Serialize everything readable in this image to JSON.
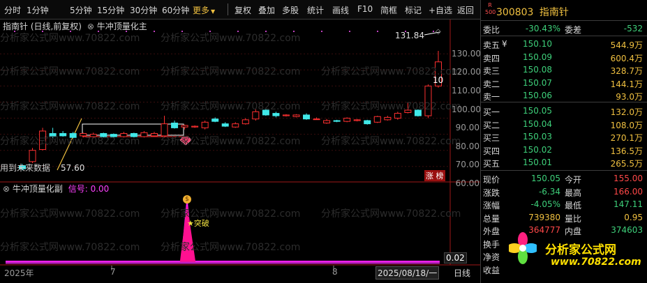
{
  "toolbar": {
    "items": [
      "分时",
      "1分钟",
      "5分钟",
      "15分钟",
      "30分钟",
      "60分钟",
      "更多"
    ],
    "active_index": 6,
    "right_items": [
      "复权",
      "叠加",
      "多股",
      "统计",
      "画线",
      "F10",
      "简框",
      "标记",
      "+自选",
      "返回"
    ]
  },
  "main_chart": {
    "title": "指南针 (日线,前复权)",
    "indicator_name": "牛冲顶量化主",
    "high_label": "131.84",
    "low_label": "57.60",
    "low_note": "用到未来数据",
    "right_tag": "涨 榜",
    "axis_ticks": [
      "130.00",
      "120.00",
      "110.00",
      "100.00",
      "90.00",
      "80.00",
      "70.00",
      "60.00"
    ],
    "cursor_value": "10"
  },
  "sub_chart": {
    "title": "牛冲顶量化副",
    "signal_label": "信号: 0.00",
    "breakout_label": "突破",
    "badge_glyph": "$",
    "axis_value": "0.02"
  },
  "time_axis": {
    "labels": [
      "2025年",
      "7",
      "8",
      "2025/08/18/一"
    ],
    "period": "日线"
  },
  "watermark": "分析家公式网www.70822.com",
  "chart_data": {
    "type": "candlestick",
    "title": "指南针 (日线,前复权)",
    "ylim": [
      56,
      134
    ],
    "high": 131.84,
    "low": 57.6,
    "candles": [
      {
        "o": 60.5,
        "c": 58.5,
        "h": 61.5,
        "l": 57.6
      },
      {
        "o": 63.0,
        "c": 70.0,
        "h": 71.5,
        "l": 62.0
      },
      {
        "o": 70.5,
        "c": 82.0,
        "h": 84.0,
        "l": 70.0
      },
      {
        "o": 80.5,
        "c": 78.5,
        "h": 84.0,
        "l": 77.5
      },
      {
        "o": 80.5,
        "c": 79.0,
        "h": 82.0,
        "l": 78.5
      },
      {
        "o": 80.5,
        "c": 78.0,
        "h": 81.5,
        "l": 77.5
      },
      {
        "o": 79.0,
        "c": 80.5,
        "h": 81.0,
        "l": 78.0
      },
      {
        "o": 78.5,
        "c": 80.0,
        "h": 81.0,
        "l": 77.5
      },
      {
        "o": 80.5,
        "c": 78.5,
        "h": 81.0,
        "l": 78.0
      },
      {
        "o": 80.0,
        "c": 78.5,
        "h": 80.5,
        "l": 77.8
      },
      {
        "o": 78.5,
        "c": 80.5,
        "h": 81.5,
        "l": 78.0
      },
      {
        "o": 80.5,
        "c": 78.5,
        "h": 81.0,
        "l": 78.0
      },
      {
        "o": 78.5,
        "c": 81.0,
        "h": 82.0,
        "l": 78.0
      },
      {
        "o": 79.0,
        "c": 80.5,
        "h": 81.5,
        "l": 78.5
      },
      {
        "o": 79.0,
        "c": 86.5,
        "h": 91.5,
        "l": 78.0
      },
      {
        "o": 87.0,
        "c": 84.0,
        "h": 88.5,
        "l": 83.5
      },
      {
        "o": 84.5,
        "c": 85.5,
        "h": 86.0,
        "l": 83.0
      },
      {
        "o": 84.5,
        "c": 85.0,
        "h": 85.5,
        "l": 84.0
      },
      {
        "o": 84.0,
        "c": 87.5,
        "h": 88.5,
        "l": 83.0
      },
      {
        "o": 89.5,
        "c": 88.0,
        "h": 90.5,
        "l": 87.5
      },
      {
        "o": 86.5,
        "c": 85.0,
        "h": 87.5,
        "l": 84.5
      },
      {
        "o": 84.5,
        "c": 86.5,
        "h": 87.5,
        "l": 84.0
      },
      {
        "o": 86.5,
        "c": 89.0,
        "h": 90.0,
        "l": 86.0
      },
      {
        "o": 89.5,
        "c": 94.0,
        "h": 95.5,
        "l": 88.5
      },
      {
        "o": 95.0,
        "c": 92.0,
        "h": 96.0,
        "l": 91.5
      },
      {
        "o": 93.0,
        "c": 91.5,
        "h": 94.0,
        "l": 90.5
      },
      {
        "o": 91.5,
        "c": 92.0,
        "h": 92.5,
        "l": 91.0
      },
      {
        "o": 91.0,
        "c": 92.0,
        "h": 92.5,
        "l": 90.5
      },
      {
        "o": 92.0,
        "c": 89.5,
        "h": 93.0,
        "l": 89.0
      },
      {
        "o": 89.5,
        "c": 89.5,
        "h": 90.5,
        "l": 89.0
      },
      {
        "o": 87.0,
        "c": 88.5,
        "h": 89.5,
        "l": 86.5
      },
      {
        "o": 88.5,
        "c": 88.0,
        "h": 89.0,
        "l": 87.5
      },
      {
        "o": 88.0,
        "c": 90.0,
        "h": 90.5,
        "l": 87.5
      },
      {
        "o": 88.5,
        "c": 89.0,
        "h": 89.5,
        "l": 88.0
      },
      {
        "o": 88.5,
        "c": 86.5,
        "h": 89.0,
        "l": 86.0
      },
      {
        "o": 87.5,
        "c": 91.0,
        "h": 91.5,
        "l": 87.0
      },
      {
        "o": 89.0,
        "c": 90.5,
        "h": 91.5,
        "l": 88.5
      },
      {
        "o": 90.0,
        "c": 93.0,
        "h": 94.0,
        "l": 89.0
      },
      {
        "o": 93.5,
        "c": 95.0,
        "h": 99.5,
        "l": 93.0
      },
      {
        "o": 95.0,
        "c": 91.5,
        "h": 95.5,
        "l": 91.0
      },
      {
        "o": 91.5,
        "c": 110.0,
        "h": 111.0,
        "l": 90.0
      },
      {
        "o": 110.0,
        "c": 125.0,
        "h": 131.84,
        "l": 109.0
      }
    ]
  },
  "right_panel": {
    "code": "300803",
    "name": "指南针",
    "badge_top": "R",
    "badge_bottom": "500",
    "weibi_label": "委比",
    "weibi_value": "-30.43%",
    "weicha_label": "委差",
    "weicha_value": "-532",
    "sell": [
      {
        "label": "卖五",
        "flag": "¥",
        "price": "150.10",
        "vol": "544.9万"
      },
      {
        "label": "卖四",
        "price": "150.09",
        "vol": "600.4万"
      },
      {
        "label": "卖三",
        "price": "150.08",
        "vol": "328.7万"
      },
      {
        "label": "卖二",
        "price": "150.07",
        "vol": "144.1万"
      },
      {
        "label": "卖一",
        "price": "150.06",
        "vol": "93.0万"
      }
    ],
    "buy": [
      {
        "label": "买一",
        "price": "150.05",
        "vol": "132.0万"
      },
      {
        "label": "买二",
        "price": "150.04",
        "vol": "108.0万"
      },
      {
        "label": "买三",
        "price": "150.03",
        "vol": "270.1万"
      },
      {
        "label": "买四",
        "price": "150.02",
        "vol": "136.5万"
      },
      {
        "label": "买五",
        "price": "150.01",
        "vol": "265.5万"
      }
    ],
    "stats": [
      {
        "l1": "现价",
        "v1": "150.05",
        "c1": "dn",
        "l2": "今开",
        "v2": "155.00",
        "c2": "up"
      },
      {
        "l1": "涨跌",
        "v1": "-6.34",
        "c1": "dn",
        "l2": "最高",
        "v2": "166.00",
        "c2": "up"
      },
      {
        "l1": "涨幅",
        "v1": "-4.05%",
        "c1": "dn",
        "l2": "最低",
        "v2": "147.11",
        "c2": "dn"
      },
      {
        "l1": "总量",
        "v1": "739380",
        "c1": "yl",
        "l2": "量比",
        "v2": "0.95",
        "c2": "yl"
      },
      {
        "l1": "外盘",
        "v1": "364777",
        "c1": "up",
        "l2": "内盘",
        "v2": "374603",
        "c2": "dn"
      },
      {
        "l1": "换手",
        "v1": "",
        "c1": "wh",
        "l2": "",
        "v2": "",
        "c2": "wh"
      },
      {
        "l1": "净资",
        "v1": "",
        "c1": "wh",
        "l2": "",
        "v2": "",
        "c2": "wh"
      },
      {
        "l1": "收益",
        "v1": "",
        "c1": "wh",
        "l2": "",
        "v2": "",
        "c2": "wh"
      }
    ],
    "logo_text": "分析家公式网",
    "logo_url": "www.70822.com"
  },
  "colors": {
    "up": "#ff3030",
    "down": "#40e8e8",
    "accent": "#f0c040",
    "magenta": "#ff20a0",
    "purple": "#c020c0"
  }
}
